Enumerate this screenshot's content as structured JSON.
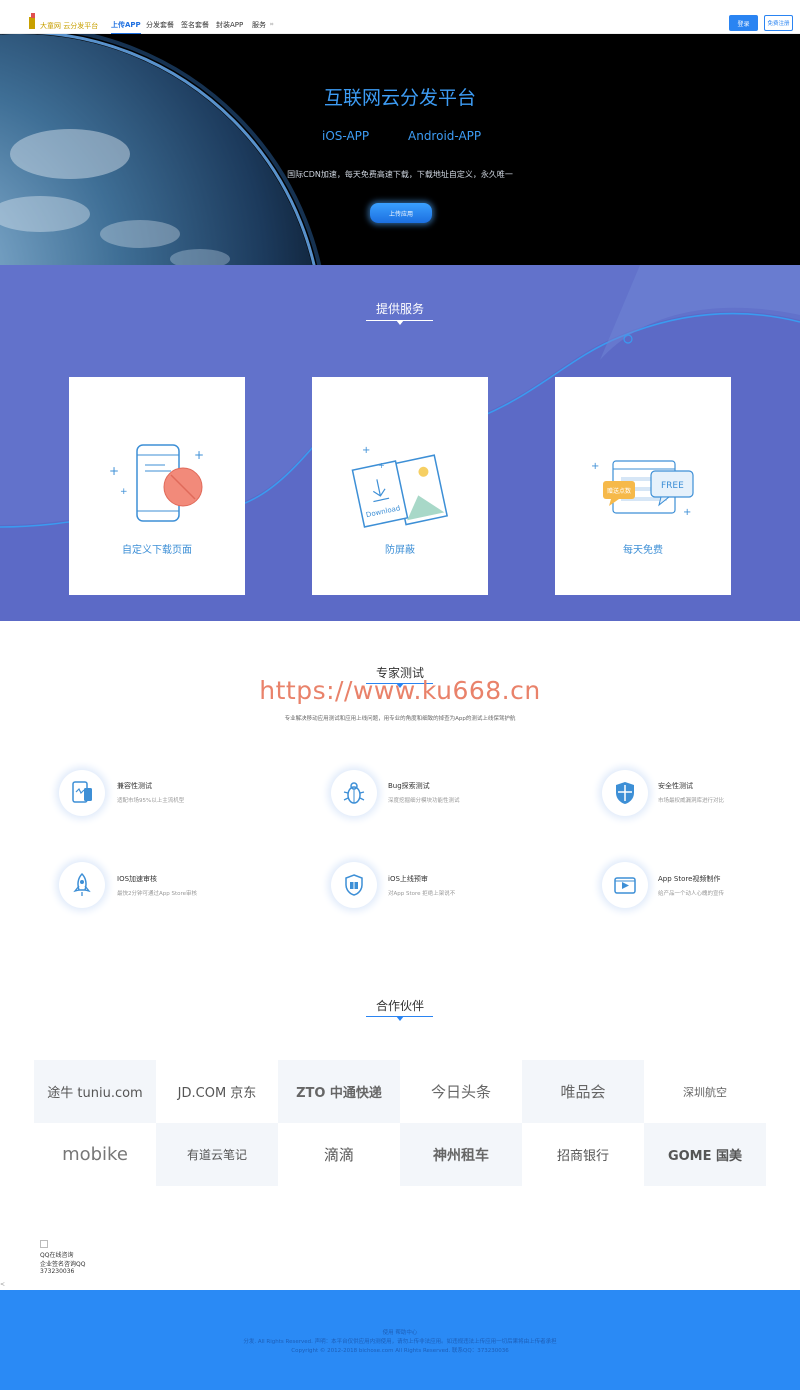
{
  "header": {
    "logo_text": "大童网 云分发平台",
    "nav": [
      "上传APP",
      "分发套餐",
      "签名套餐",
      "封装APP",
      "服务"
    ],
    "nav_more": "⌗",
    "login": "登录",
    "register": "免费注册"
  },
  "hero": {
    "title": "互联网云分发平台",
    "ios_link": "iOS-APP",
    "android_link": "Android-APP",
    "description": "国际CDN加速，每天免费高速下载，下载地址自定义，永久唯一",
    "upload_button": "上传应用"
  },
  "services": {
    "title": "提供服务",
    "cards": [
      {
        "label": "自定义下载页面",
        "icon": "phone-block-icon"
      },
      {
        "label": "防屏蔽",
        "icon": "download-photo-icon"
      },
      {
        "label": "每天免费",
        "icon": "free-chat-icon",
        "badge_text": "FREE",
        "bubble_text": "赠送点数",
        "image_text": "Download"
      }
    ]
  },
  "expert": {
    "title": "专家测试",
    "watermark": "https://www.ku668.cn",
    "subtitle": "专业解决移动应用测试和应用上线问题，用专业的角度和细致的掉查为App的测试上线保驾护航",
    "features": [
      {
        "title": "兼容性测试",
        "desc": "适配市场95%以上主流机型",
        "icon": "compat-icon"
      },
      {
        "title": "Bug探索测试",
        "desc": "深度挖掘细分模块功能性测试",
        "icon": "bug-icon"
      },
      {
        "title": "安全性测试",
        "desc": "市场最权威漏洞库进行对比",
        "icon": "shield-icon"
      },
      {
        "title": "IOS加速审核",
        "desc": "最快2分钟可通过App Store审核",
        "icon": "rocket-icon"
      },
      {
        "title": "iOS上线预审",
        "desc": "对App Store 拒绝上架说不",
        "icon": "review-shield-icon"
      },
      {
        "title": "App Store视频制作",
        "desc": "给产品一个动人心魄的宣传",
        "icon": "video-icon"
      }
    ]
  },
  "partners": {
    "title": "合作伙伴",
    "logos": [
      "途牛 tuniu.com",
      "JD.COM 京东",
      "ZTO 中通快递",
      "今日头条",
      "唯品会",
      "深圳航空",
      "mobike",
      "有道云笔记",
      "滴滴",
      "神州租车",
      "招商银行",
      "GOME 国美"
    ]
  },
  "qq": {
    "lines": [
      "QQ在线咨询",
      "企业签名咨询QQ",
      "373230036"
    ]
  },
  "footer": {
    "lines": [
      "使用 帮助中心",
      "分发. All Rights Reserved. 声明：本平台仅供应用内测使用，请勿上传非法应用。如违规违法上传应用一切后果将由上传者承担",
      "Copyright © 2012-2018 bichose.com All Rights Reserved. 联系QQ：373230036"
    ]
  },
  "colors": {
    "primary": "#2a84f2",
    "hero_text": "#3d9cf4",
    "services_bg": "#6272cb",
    "footer_bg": "#2a8af5",
    "watermark": "#e9826a"
  }
}
